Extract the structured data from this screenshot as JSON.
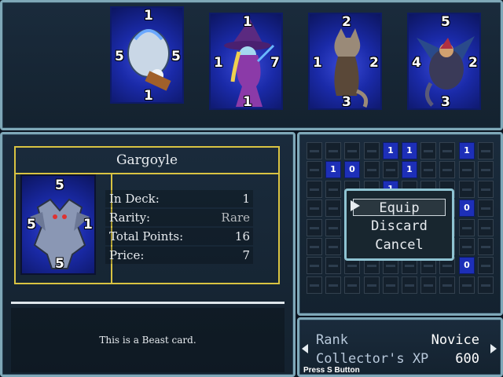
{
  "hand": [
    {
      "name": "card-spirit-jar",
      "top": "1",
      "left": "5",
      "right": "5",
      "bottom": "1",
      "art": "jar"
    },
    {
      "name": "card-witch",
      "top": "1",
      "left": "1",
      "right": "7",
      "bottom": "1",
      "art": "witch"
    },
    {
      "name": "card-cat",
      "top": "2",
      "left": "1",
      "right": "2",
      "bottom": "3",
      "art": "cat"
    },
    {
      "name": "card-dragon-rider",
      "top": "5",
      "left": "4",
      "right": "2",
      "bottom": "3",
      "art": "dragon"
    }
  ],
  "selected_card": {
    "title": "Gargoyle",
    "top": "5",
    "left": "5",
    "right": "1",
    "bottom": "5",
    "stats": [
      {
        "label": "In Deck:",
        "value": "1"
      },
      {
        "label": "Rarity:",
        "value": "Rare"
      },
      {
        "label": "Total Points:",
        "value": "16"
      },
      {
        "label": "Price:",
        "value": "7"
      }
    ],
    "description": "This is a Beast card."
  },
  "collection_owned": [
    {
      "row": 0,
      "col": 4,
      "count": "1"
    },
    {
      "row": 0,
      "col": 5,
      "count": "1"
    },
    {
      "row": 0,
      "col": 8,
      "count": "1"
    },
    {
      "row": 1,
      "col": 1,
      "count": "1"
    },
    {
      "row": 1,
      "col": 2,
      "count": "0"
    },
    {
      "row": 1,
      "col": 5,
      "count": "1"
    },
    {
      "row": 2,
      "col": 4,
      "count": "1"
    },
    {
      "row": 3,
      "col": 8,
      "count": "0"
    },
    {
      "row": 6,
      "col": 8,
      "count": "0"
    }
  ],
  "menu": {
    "items": [
      "Equip",
      "Discard",
      "Cancel"
    ],
    "selected": 0
  },
  "rank": {
    "rank_label": "Rank",
    "rank_value": "Novice",
    "xp_label": "Collector's XP",
    "xp_value": "600"
  },
  "hint": "Press S Button",
  "colors": {
    "card_blue": "#1d2fb8",
    "frame_gold": "#d9c342",
    "window_border": "#7fa8b8"
  }
}
